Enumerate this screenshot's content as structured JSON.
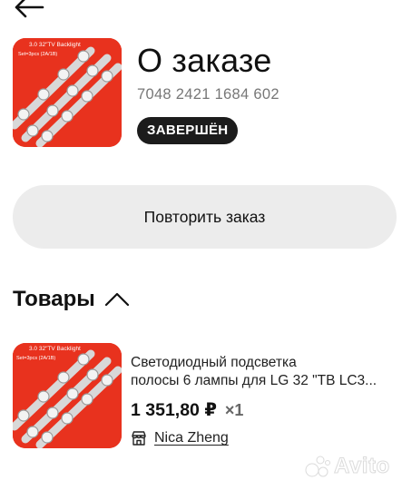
{
  "header": {
    "back_icon": "arrow-left-icon",
    "title": "О заказе"
  },
  "order": {
    "number": "7048 2421 1684 602",
    "status": "ЗАВЕРШЁН",
    "thumb_caption_line1": "3.0  32\"TV Backlight",
    "thumb_caption_line2": "Set=3pcs  (2A/1B)"
  },
  "actions": {
    "repeat_label": "Повторить заказ"
  },
  "products_section": {
    "title": "Товары",
    "toggle_icon": "chevron-up-icon"
  },
  "products": [
    {
      "name_line1": "Светодиодный подсветка",
      "name_line2": "полосы 6 лампы для LG 32 \"ТВ LC3...",
      "price": "1 351,80 ₽",
      "quantity": "×1",
      "seller_icon": "shop-icon",
      "seller": "Nica Zheng",
      "thumb_caption_line1": "3.0  32\"TV Backlight",
      "thumb_caption_line2": "Set=3pcs  (2A/1B)"
    }
  ],
  "watermark": {
    "text": "Avito",
    "icon": "avito-logo-icon"
  },
  "colors": {
    "thumb_bg": "#e8321e",
    "badge_bg": "#1c1c1c",
    "button_bg": "#ececec"
  }
}
